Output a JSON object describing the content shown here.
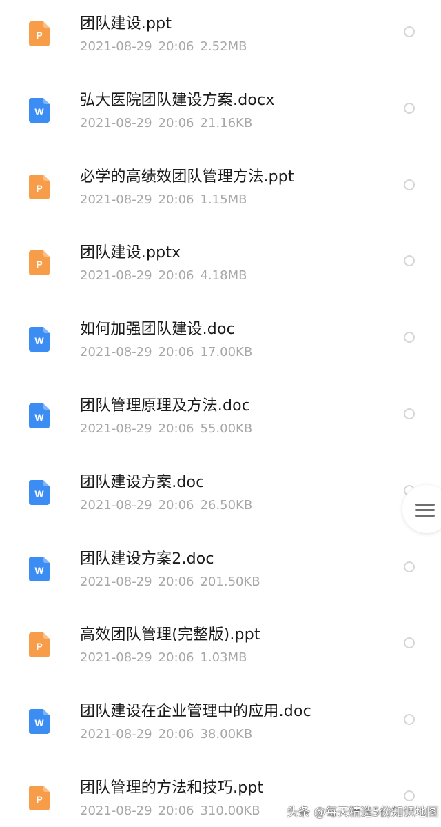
{
  "files": [
    {
      "name": "团队建设.ppt",
      "date": "2021-08-29",
      "time": "20:06",
      "size": "2.52MB",
      "type": "ppt",
      "icon": "ppt-file-icon",
      "letter": "P"
    },
    {
      "name": "弘大医院团队建设方案.docx",
      "date": "2021-08-29",
      "time": "20:06",
      "size": "21.16KB",
      "type": "doc",
      "icon": "word-file-icon",
      "letter": "W"
    },
    {
      "name": "必学的高绩效团队管理方法.ppt",
      "date": "2021-08-29",
      "time": "20:06",
      "size": "1.15MB",
      "type": "ppt",
      "icon": "ppt-file-icon",
      "letter": "P"
    },
    {
      "name": "团队建设.pptx",
      "date": "2021-08-29",
      "time": "20:06",
      "size": "4.18MB",
      "type": "ppt",
      "icon": "ppt-file-icon",
      "letter": "P"
    },
    {
      "name": "如何加强团队建设.doc",
      "date": "2021-08-29",
      "time": "20:06",
      "size": "17.00KB",
      "type": "doc",
      "icon": "word-file-icon",
      "letter": "W"
    },
    {
      "name": "团队管理原理及方法.doc",
      "date": "2021-08-29",
      "time": "20:06",
      "size": "55.00KB",
      "type": "doc",
      "icon": "word-file-icon",
      "letter": "W"
    },
    {
      "name": "团队建设方案.doc",
      "date": "2021-08-29",
      "time": "20:06",
      "size": "26.50KB",
      "type": "doc",
      "icon": "word-file-icon",
      "letter": "W"
    },
    {
      "name": "团队建设方案2.doc",
      "date": "2021-08-29",
      "time": "20:06",
      "size": "201.50KB",
      "type": "doc",
      "icon": "word-file-icon",
      "letter": "W"
    },
    {
      "name": "高效团队管理(完整版).ppt",
      "date": "2021-08-29",
      "time": "20:06",
      "size": "1.03MB",
      "type": "ppt",
      "icon": "ppt-file-icon",
      "letter": "P"
    },
    {
      "name": "团队建设在企业管理中的应用.doc",
      "date": "2021-08-29",
      "time": "20:06",
      "size": "38.00KB",
      "type": "doc",
      "icon": "word-file-icon",
      "letter": "W"
    },
    {
      "name": "团队管理的方法和技巧.ppt",
      "date": "2021-08-29",
      "time": "20:06",
      "size": "310.00KB",
      "type": "ppt",
      "icon": "ppt-file-icon",
      "letter": "P"
    }
  ],
  "colors": {
    "ppt": "#f79d4a",
    "doc": "#3b8cf3",
    "name_text": "#1a1a1a",
    "meta_text": "#a7a7a7"
  },
  "side_handle": {
    "icon": "menu-icon"
  },
  "watermark": "头条 @每天精选5份知识地图"
}
